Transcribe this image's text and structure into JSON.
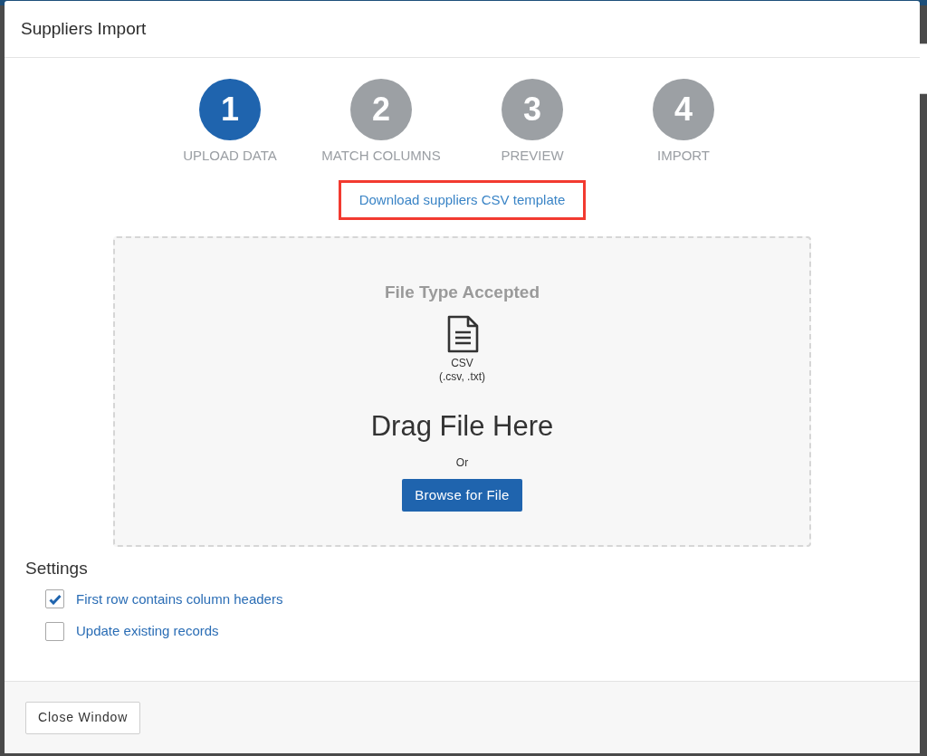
{
  "window": {
    "title": "Suppliers Import"
  },
  "steps": [
    {
      "number": "1",
      "label": "UPLOAD DATA",
      "selected": true
    },
    {
      "number": "2",
      "label": "MATCH COLUMNS",
      "selected": false
    },
    {
      "number": "3",
      "label": "PREVIEW",
      "selected": false
    },
    {
      "number": "4",
      "label": "IMPORT",
      "selected": false
    }
  ],
  "template_link": {
    "label": "Download suppliers CSV template",
    "highlighted": true
  },
  "drop_zone": {
    "heading": "File Type Accepted",
    "file_type": "CSV",
    "extensions": "(.csv, .txt)",
    "title": "Drag File Here",
    "separator": "Or",
    "button": "Browse for File"
  },
  "settings": {
    "title": "Settings",
    "options": [
      {
        "label": "First row contains column headers",
        "checked": true
      },
      {
        "label": "Update existing records",
        "checked": false
      }
    ]
  },
  "footer": {
    "button": "Close Window"
  }
}
